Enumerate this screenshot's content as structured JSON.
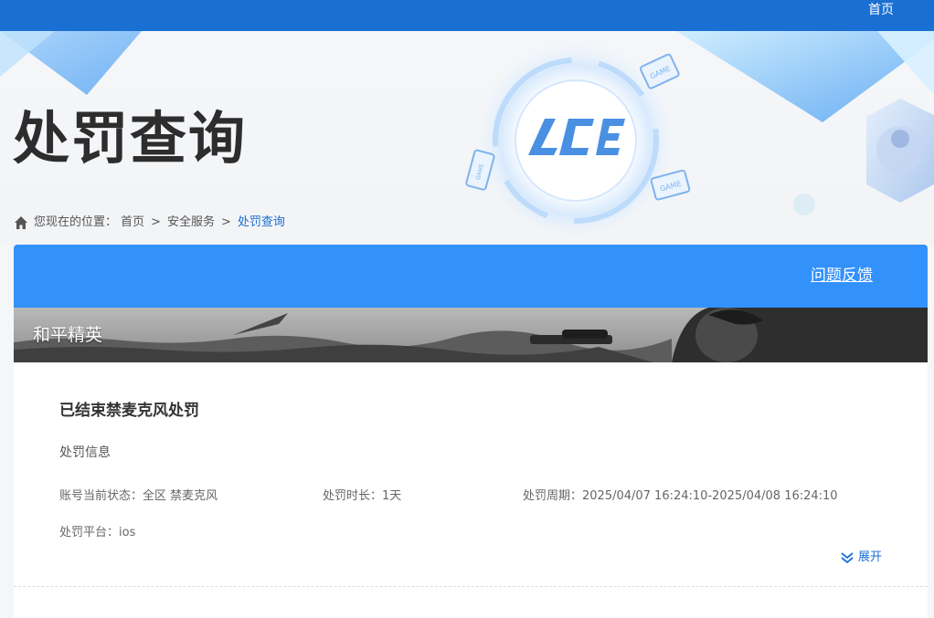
{
  "topbar": {
    "home_label": "首页"
  },
  "hero": {
    "title": "处罚查询",
    "logo_text": "ACE",
    "game_tags": [
      "GAME",
      "GAME",
      "GAME"
    ]
  },
  "breadcrumb": {
    "prefix": "您现在的位置：",
    "items": [
      "首页",
      "安全服务",
      "处罚查询"
    ],
    "separator": ">"
  },
  "card": {
    "feedback_label": "问题反馈",
    "game_name": "和平精英"
  },
  "record": {
    "title": "已结束禁麦克风处罚",
    "subtitle": "处罚信息",
    "status": "账号当前状态：全区 禁麦克风",
    "duration": "处罚时长：1天",
    "period": "处罚周期：2025/04/07 16:24:10-2025/04/08 16:24:10",
    "platform": "处罚平台：ios",
    "expand_label": "展开"
  },
  "colors": {
    "topbar": "#1a6fd3",
    "card_header": "#3391fb",
    "link": "#1a6fd3"
  }
}
